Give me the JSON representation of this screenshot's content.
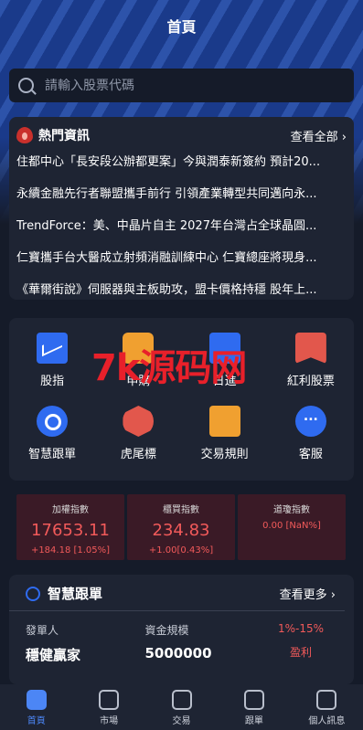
{
  "header": {
    "title": "首頁"
  },
  "search": {
    "placeholder": "請輸入股票代碼"
  },
  "news": {
    "title": "熱門資訊",
    "more_label": "查看全部 ›",
    "items": [
      "住都中心「長安段公辦都更案」今與潤泰新簽約 預計20...",
      "永續金融先行者聯盟攜手前行 引領產業轉型共同邁向永...",
      "TrendForce：美、中晶片自主 2027年台灣占全球晶圓...",
      "仁寶攜手台大醫成立射頻消融訓練中心 仁寶總座將現身...",
      "《華爾街說》伺服器與主板助攻，盟卡價格持穩 股年上..."
    ]
  },
  "menu": {
    "items": [
      {
        "label": "股指",
        "icon": "chart-icon"
      },
      {
        "label": "申購",
        "icon": "bag-icon"
      },
      {
        "label": "日進",
        "icon": "folder-icon"
      },
      {
        "label": "紅利股票",
        "icon": "bonus-icon"
      },
      {
        "label": "智慧跟單",
        "icon": "target-icon"
      },
      {
        "label": "虎尾標",
        "icon": "flag-icon"
      },
      {
        "label": "交易規則",
        "icon": "rules-icon"
      },
      {
        "label": "客服",
        "icon": "chat-icon"
      }
    ]
  },
  "watermark": "7k源码网",
  "indices": [
    {
      "name": "加權指數",
      "value": "17653.11",
      "change": "+184.18 [1.05%]"
    },
    {
      "name": "櫃買指數",
      "value": "234.83",
      "change": "+1.00[0.43%]"
    },
    {
      "name": "道瓊指數",
      "value": "0.00 [NaN%]",
      "change": ""
    }
  ],
  "copy_trade": {
    "title": "智慧跟單",
    "more_label": "查看更多 ›",
    "publisher_label": "發單人",
    "funds_label": "資金規模",
    "publisher": "穩健贏家",
    "funds": "5000000",
    "range": "1%-15%",
    "profit_label": "盈利"
  },
  "tabbar": [
    {
      "label": "首頁",
      "active": true
    },
    {
      "label": "市場"
    },
    {
      "label": "交易"
    },
    {
      "label": "跟單"
    },
    {
      "label": "個人訊息"
    }
  ],
  "colors": {
    "accent": "#4c86f5",
    "rise": "#f25a5a",
    "bg": "#151b29",
    "card": "#1e2433"
  }
}
